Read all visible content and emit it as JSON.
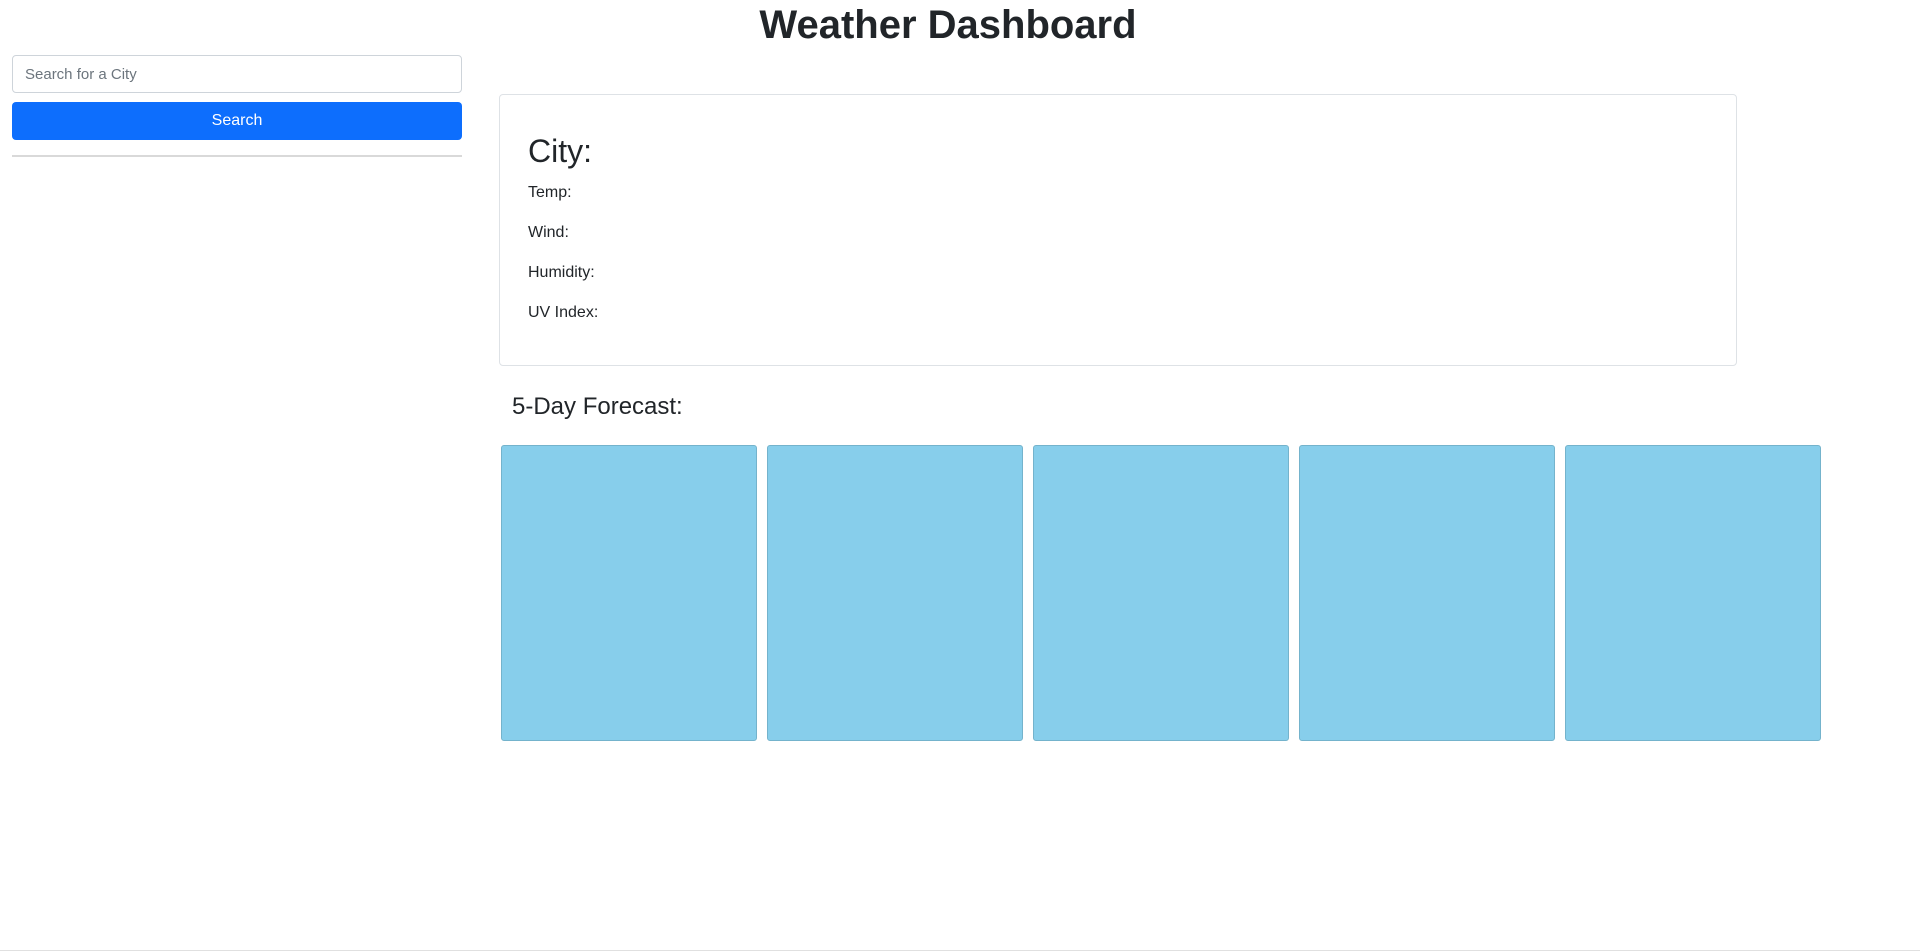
{
  "header": {
    "title": "Weather Dashboard"
  },
  "sidebar": {
    "search_placeholder": "Search for a City",
    "search_value": "",
    "search_button_label": "Search"
  },
  "current_weather": {
    "city_label": "City:",
    "temp_label": "Temp:",
    "wind_label": "Wind:",
    "humidity_label": "Humidity:",
    "uv_label": "UV Index:"
  },
  "forecast": {
    "heading": "5-Day Forecast:",
    "cards": [
      {
        "text": ""
      },
      {
        "text": ""
      },
      {
        "text": ""
      },
      {
        "text": ""
      },
      {
        "text": ""
      }
    ]
  },
  "colors": {
    "primary_button": "#0d6efd",
    "forecast_card": "#87ceeb"
  }
}
